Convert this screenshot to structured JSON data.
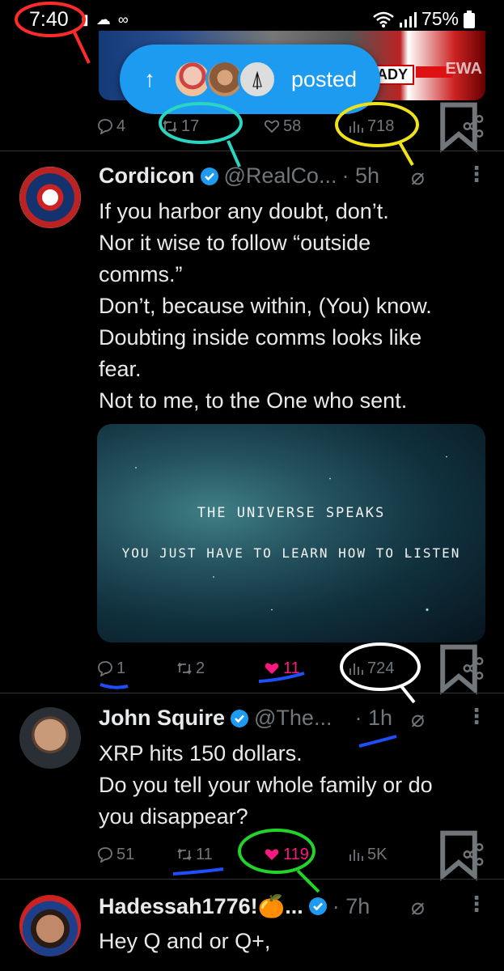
{
  "status_bar": {
    "time": "7:40",
    "left_icons": "▮ ☁ ∞",
    "battery": "75%"
  },
  "top_tweet": {
    "media_text": {
      "ady": "ADY",
      "way": "EWA"
    },
    "posted_pill": {
      "arrow": "↑",
      "label": "posted"
    },
    "actions": {
      "replies": "4",
      "reposts": "17",
      "likes": "58",
      "views": "718"
    }
  },
  "tweets": [
    {
      "name": "Cordicon",
      "handle": "@RealCo...",
      "time": "· 5h",
      "lines": [
        "If you harbor any doubt, don’t.",
        "Nor it wise to follow “outside",
        "comms.”",
        "Don’t, because within, (You) know.",
        "Doubting inside comms looks like",
        "fear.",
        "Not to me, to the One who sent."
      ],
      "media": {
        "line1": "THE UNIVERSE SPEAKS",
        "line2": "YOU JUST HAVE TO LEARN HOW TO LISTEN"
      },
      "actions": {
        "replies": "1",
        "reposts": "2",
        "likes": "11",
        "views": "724"
      }
    },
    {
      "name": "John Squire",
      "handle": "@The...",
      "time": "· 1h",
      "lines": [
        "XRP hits 150 dollars.",
        "Do you tell your whole family or do",
        "you disappear?"
      ],
      "actions": {
        "replies": "51",
        "reposts": "11",
        "likes": "119",
        "views": "5K"
      }
    },
    {
      "name": "Hadessah1776!🍊...",
      "time": "· 7h",
      "lines": [
        "Hey Q and or Q+,"
      ]
    }
  ],
  "colors": {
    "accent": "#1d9bf0",
    "like": "#f91880",
    "muted": "#71767b"
  }
}
